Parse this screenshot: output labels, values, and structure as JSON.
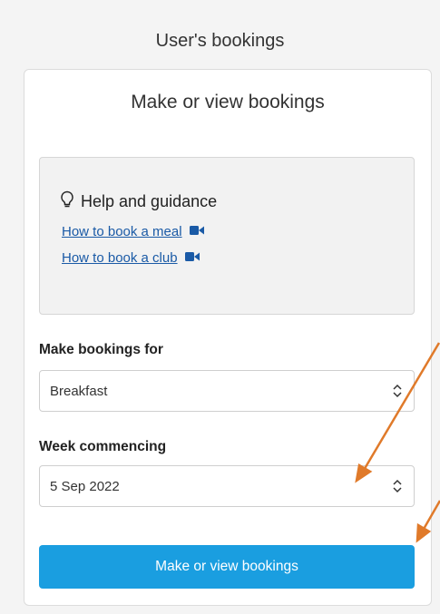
{
  "header": {
    "title": "User's bookings"
  },
  "card": {
    "title": "Make or view bookings",
    "help": {
      "heading": "Help and guidance",
      "icon": "lightbulb-icon",
      "links": [
        {
          "label": "How to book a meal",
          "icon": "video-icon"
        },
        {
          "label": "How to book a club",
          "icon": "video-icon"
        }
      ]
    },
    "meal_field": {
      "label": "Make bookings for",
      "value": "Breakfast"
    },
    "week_field": {
      "label": "Week commencing",
      "value": "5 Sep 2022"
    },
    "submit_label": "Make or view bookings"
  },
  "colors": {
    "accent": "#1a9ee0",
    "link": "#1a5aa6",
    "annotation_arrow": "#e07a2a"
  }
}
